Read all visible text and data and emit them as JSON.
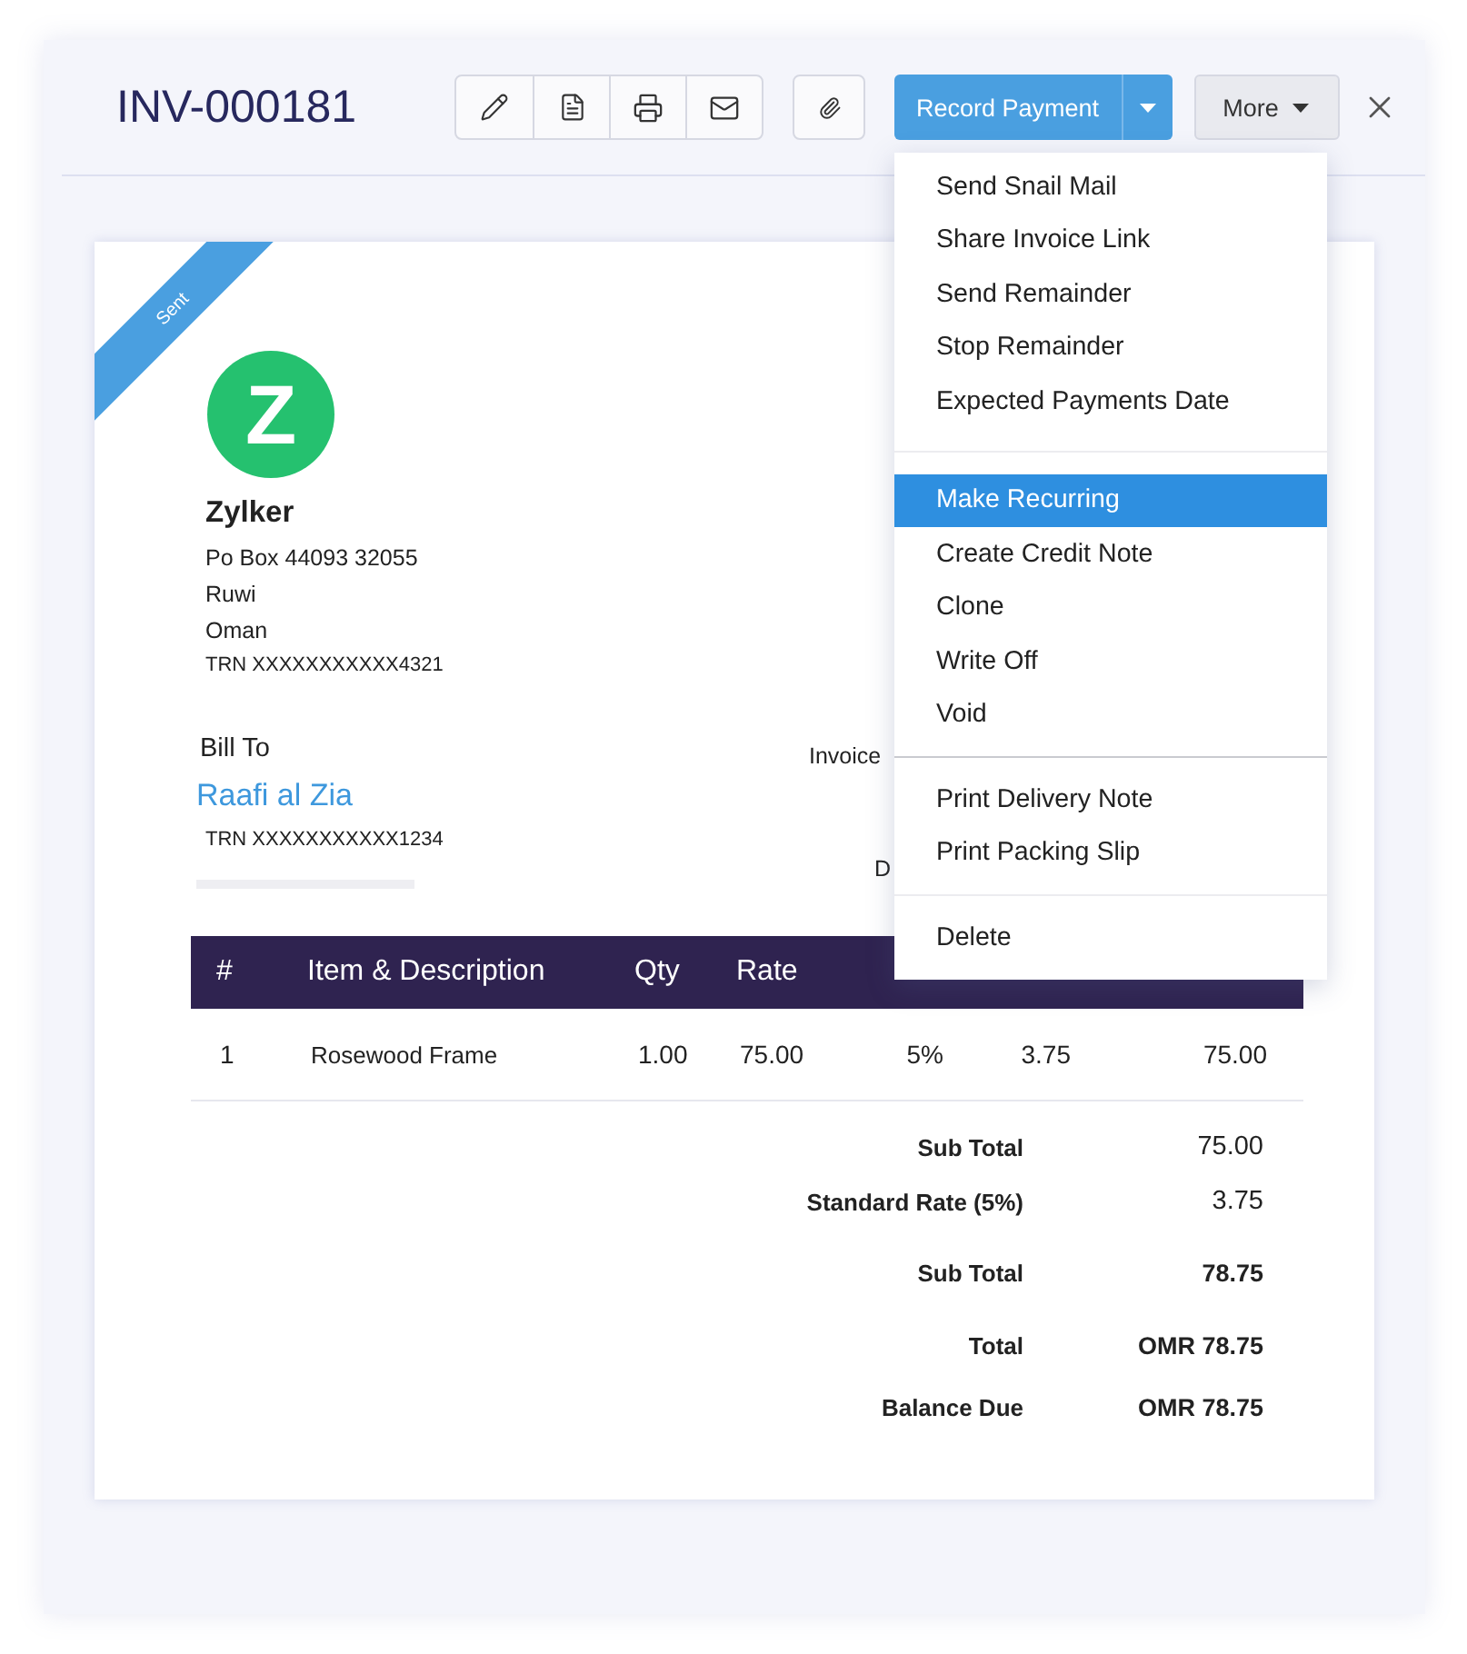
{
  "header": {
    "title": "INV-000181",
    "record_payment": "Record Payment",
    "more": "More"
  },
  "menu": {
    "groups": [
      [
        {
          "label": "Send Snail Mail",
          "selected": false
        },
        {
          "label": "Share Invoice Link",
          "selected": false
        },
        {
          "label": "Send Remainder",
          "selected": false
        },
        {
          "label": "Stop Remainder",
          "selected": false
        },
        {
          "label": "Expected Payments Date",
          "selected": false
        }
      ],
      [
        {
          "label": "Make Recurring",
          "selected": true
        },
        {
          "label": "Create Credit Note",
          "selected": false
        },
        {
          "label": "Clone",
          "selected": false
        },
        {
          "label": "Write Off",
          "selected": false
        },
        {
          "label": "Void",
          "selected": false
        }
      ],
      [
        {
          "label": "Print Delivery Note",
          "selected": false
        },
        {
          "label": "Print Packing Slip",
          "selected": false
        }
      ],
      [
        {
          "label": "Delete",
          "selected": false
        }
      ]
    ]
  },
  "invoice": {
    "status": "Sent",
    "logo_letter": "Z",
    "company": "Zylker",
    "address": [
      "Po Box 44093 32055",
      "Ruwi",
      "Oman"
    ],
    "company_trn": "TRN XXXXXXXXXXX4321",
    "bill_to_label": "Bill To",
    "customer": "Raafi al Zia",
    "customer_trn": "TRN XXXXXXXXXXX1234",
    "invoice_label": "Invoice",
    "date_label_fragment": "D",
    "table": {
      "columns": [
        "#",
        "Item & Description",
        "Qty",
        "Rate"
      ],
      "rows": [
        [
          "1",
          "Rosewood Frame",
          "1.00",
          "75.00",
          "5%",
          "3.75",
          "75.00"
        ]
      ]
    },
    "totals": [
      {
        "label": "Sub Total",
        "value": "75.00",
        "kind": "light"
      },
      {
        "label": "Standard Rate (5%)",
        "value": "3.75",
        "kind": "light"
      },
      {
        "label": "Sub Total",
        "value": "78.75",
        "kind": "strong"
      },
      {
        "label": "Total",
        "value": "OMR 78.75",
        "kind": "strong"
      },
      {
        "label": "Balance Due",
        "value": "OMR 78.75",
        "kind": "strong"
      }
    ]
  }
}
